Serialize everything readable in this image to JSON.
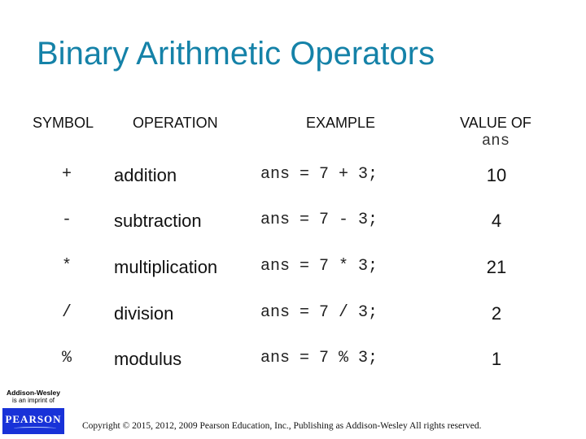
{
  "slide": {
    "title": "Binary Arithmetic Operators",
    "title_color": "#1582a8",
    "headers": {
      "symbol": "SYMBOL",
      "operation": "OPERATION",
      "example": "EXAMPLE",
      "value_of": "VALUE OF",
      "value_of_var": "ans"
    },
    "rows": [
      {
        "symbol": "+",
        "operation": "addition",
        "example": "ans = 7 + 3;",
        "value": "10"
      },
      {
        "symbol": "-",
        "operation": "subtraction",
        "example": "ans = 7 - 3;",
        "value": "4"
      },
      {
        "symbol": "*",
        "operation": "multiplication",
        "example": "ans = 7 * 3;",
        "value": "21"
      },
      {
        "symbol": "/",
        "operation": "division",
        "example": "ans = 7 / 3;",
        "value": "2"
      },
      {
        "symbol": "%",
        "operation": "modulus",
        "example": "ans = 7 % 3;",
        "value": "1"
      }
    ]
  },
  "footer": {
    "logo_line1": "Addison-Wesley",
    "logo_line2": "is an imprint of",
    "logo_brand": "PEARSON",
    "logo_brand_color": "#1832d8",
    "copyright": "Copyright © 2015, 2012, 2009 Pearson Education, Inc., Publishing as Addison-Wesley All rights reserved."
  }
}
